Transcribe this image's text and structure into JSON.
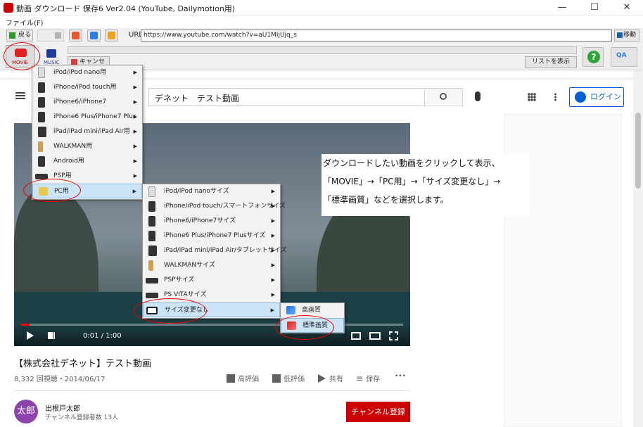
{
  "window": {
    "title": "動画 ダウンロード 保存6 Ver2.04 (YouTube, Dailymotion用)",
    "min": "—",
    "max": "☐",
    "close": "✕"
  },
  "menu": {
    "file": "ファイル(F)"
  },
  "toolbar": {
    "back": "戻る",
    "url_label": "URL:",
    "url": "https://www.youtube.com/watch?v=aU1MIjUjq_s",
    "go": "移動"
  },
  "ribbon": {
    "movie": "MOVIE",
    "music": "MUSIC",
    "cancel": "キャンセル",
    "list": "リストを表示",
    "help": "?",
    "qa": "QA"
  },
  "youtube": {
    "search_value": "デネット　テスト動画",
    "login": "ログイン",
    "video_time": "0:01 / 1:00",
    "video_title": "【株式会社デネット】テスト動画",
    "video_meta": "8,332 回視聴・2014/06/17",
    "like": "高評価",
    "dislike": "低評価",
    "share": "共有",
    "save": "保存",
    "more": "•••",
    "avatar": "太郎",
    "channel_name": "出根戸太郎",
    "channel_subs": "チャンネル登録者数 13人",
    "subscribe": "チャンネル登録"
  },
  "menu1": [
    "iPod/iPod nano用",
    "iPhone/iPod touch用",
    "iPhone6/iPhone7",
    "iPhone6 Plus/iPhone7 Plus",
    "iPad/iPad mini/iPad Air用",
    "WALKMAN用",
    "Android用",
    "PSP用",
    "PC用"
  ],
  "menu2": [
    "iPod/iPod nanoサイズ",
    "iPhone/iPod touch/スマートフォンサイズ",
    "iPhone6/iPhone7サイズ",
    "iPhone6 Plus/iPhone7 Plusサイズ",
    "iPad/iPad mini/iPad Air/タブレットサイズ",
    "WALKMANサイズ",
    "PSPサイズ",
    "PS VITAサイズ",
    "サイズ変更なし"
  ],
  "menu3": [
    "高画質",
    "標準画質"
  ],
  "callout": {
    "line1": "ダウンロードしたい動画をクリックして表示、",
    "line2": "「MOVIE」→「PC用」→「サイズ変更なし」→",
    "line3": "「標準画質」などを選択します。"
  },
  "colors": {
    "accent": "#065fd4",
    "highlight_circle": "#ee0000",
    "subscribe": "#cc0000"
  }
}
